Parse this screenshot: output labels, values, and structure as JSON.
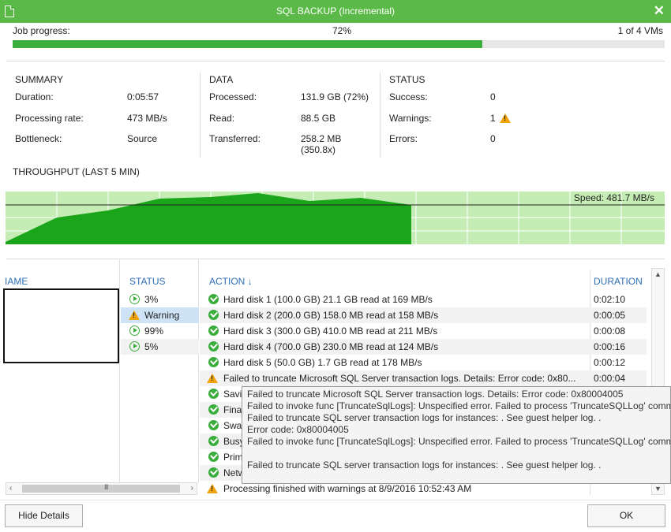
{
  "window": {
    "title": "SQL BACKUP (Incremental)",
    "accent": "#5bba47"
  },
  "job": {
    "label": "Job progress:",
    "percent": "72%",
    "progress_fraction": 0.72,
    "vms": "1 of 4 VMs"
  },
  "summary": {
    "heading": "SUMMARY",
    "duration_label": "Duration:",
    "duration": "0:05:57",
    "rate_label": "Processing rate:",
    "rate": "473 MB/s",
    "bottleneck_label": "Bottleneck:",
    "bottleneck": "Source"
  },
  "data": {
    "heading": "DATA",
    "processed_label": "Processed:",
    "processed": "131.9 GB (72%)",
    "read_label": "Read:",
    "read": "88.5 GB",
    "transferred_label": "Transferred:",
    "transferred": "258.2 MB (350.8x)"
  },
  "status": {
    "heading": "STATUS",
    "success_label": "Success:",
    "success": "0",
    "warnings_label": "Warnings:",
    "warnings": "1",
    "errors_label": "Errors:",
    "errors": "0"
  },
  "throughput": {
    "title": "THROUGHPUT (LAST 5 MIN)",
    "speed": "Speed: 481.7 MB/s"
  },
  "columns": {
    "name": "IAME",
    "status": "STATUS",
    "action": "ACTION",
    "sort_arrow": "↓",
    "duration": "DURATION"
  },
  "vms": [
    {
      "status": "3%",
      "icon": "play-icon"
    },
    {
      "status": "Warning",
      "icon": "warning-icon"
    },
    {
      "status": "99%",
      "icon": "play-icon"
    },
    {
      "status": "5%",
      "icon": "play-icon"
    }
  ],
  "actions": [
    {
      "text": "Hard disk 1 (100.0 GB) 21.1 GB read at 169 MB/s",
      "duration": "0:02:10",
      "icon": "check-icon"
    },
    {
      "text": "Hard disk 2 (200.0 GB) 158.0 MB read at 158 MB/s",
      "duration": "0:00:05",
      "icon": "check-icon"
    },
    {
      "text": "Hard disk 3 (300.0 GB) 410.0 MB read at 211 MB/s",
      "duration": "0:00:08",
      "icon": "check-icon"
    },
    {
      "text": "Hard disk 4 (700.0 GB) 230.0 MB read at 124 MB/s",
      "duration": "0:00:16",
      "icon": "check-icon"
    },
    {
      "text": "Hard disk 5 (50.0 GB) 1.7 GB read at 178 MB/s",
      "duration": "0:00:12",
      "icon": "check-icon"
    },
    {
      "text": "Failed to truncate Microsoft SQL Server transaction logs. Details:  Error code: 0x80...",
      "duration": "0:00:04",
      "icon": "warning-icon"
    },
    {
      "text": "Savi",
      "duration": "",
      "icon": "check-icon"
    },
    {
      "text": "Fina",
      "duration": "",
      "icon": "check-icon"
    },
    {
      "text": "Swap",
      "duration": "",
      "icon": "check-icon"
    },
    {
      "text": "Busy",
      "duration": "",
      "icon": "check-icon"
    },
    {
      "text": "Prim",
      "duration": "",
      "icon": "check-icon"
    },
    {
      "text": "Netw",
      "duration": "",
      "icon": "check-icon"
    },
    {
      "text": "Processing finished with warnings at 8/9/2016 10:52:43 AM",
      "duration": "",
      "icon": "warning-icon"
    }
  ],
  "tooltip": [
    "Failed to truncate Microsoft SQL Server transaction logs. Details:  Error code: 0x80004005",
    "Failed to invoke func [TruncateSqlLogs]: Unspecified error. Failed to process 'TruncateSQLLog' comma",
    "Failed to truncate SQL server transaction logs for instances:  . See guest helper log. .",
    " Error code: 0x80004005",
    "Failed to invoke func [TruncateSqlLogs]: Unspecified error. Failed to process 'TruncateSQLLog' comma",
    "",
    "Failed to truncate SQL server transaction logs for instances:  . See guest helper log. ."
  ],
  "buttons": {
    "hide_details": "Hide Details",
    "ok": "OK"
  },
  "scroll": {
    "grip": "III"
  }
}
